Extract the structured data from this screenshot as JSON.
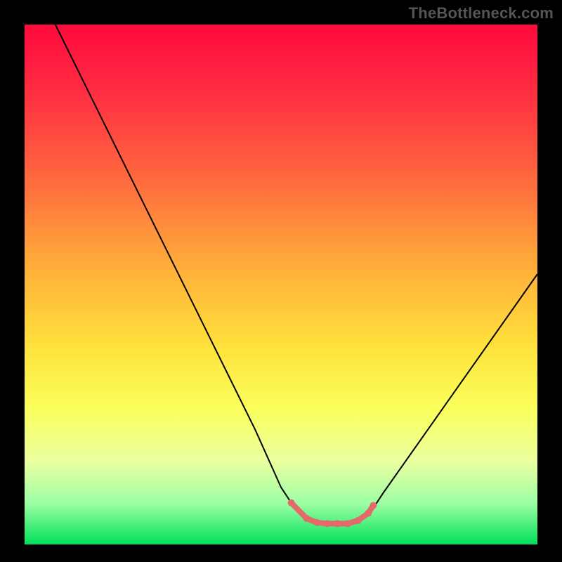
{
  "watermark": "TheBottleneck.com",
  "chart_data": {
    "type": "line",
    "title": "",
    "xlabel": "",
    "ylabel": "",
    "xlim": [
      0,
      100
    ],
    "ylim": [
      0,
      100
    ],
    "series": [
      {
        "name": "curve",
        "x": [
          6,
          10,
          15,
          20,
          25,
          30,
          35,
          40,
          45,
          50,
          52,
          55,
          58,
          62,
          65,
          68,
          70,
          75,
          80,
          85,
          90,
          95,
          100
        ],
        "values": [
          100,
          92,
          82,
          72,
          62,
          52,
          42,
          32,
          22,
          11,
          8,
          5,
          4,
          4,
          5,
          7,
          10,
          17,
          24,
          31,
          38,
          45,
          52
        ]
      }
    ],
    "markers": [
      {
        "name": "flat-region",
        "x": [
          52,
          55,
          57,
          59,
          61,
          63,
          65,
          67,
          68
        ],
        "y": [
          8,
          5,
          4.2,
          4,
          4,
          4,
          4.6,
          6,
          7.5
        ]
      }
    ],
    "marker_color": "#e46a6a",
    "gradient_stops": [
      {
        "pos": 0.0,
        "color": "#ff0a3c"
      },
      {
        "pos": 0.12,
        "color": "#ff2a42"
      },
      {
        "pos": 0.3,
        "color": "#ff6a3e"
      },
      {
        "pos": 0.48,
        "color": "#ffb339"
      },
      {
        "pos": 0.62,
        "color": "#ffe23c"
      },
      {
        "pos": 0.74,
        "color": "#fbff5c"
      },
      {
        "pos": 0.84,
        "color": "#eaffa0"
      },
      {
        "pos": 0.92,
        "color": "#9effa5"
      },
      {
        "pos": 1.0,
        "color": "#00e05a"
      }
    ]
  }
}
